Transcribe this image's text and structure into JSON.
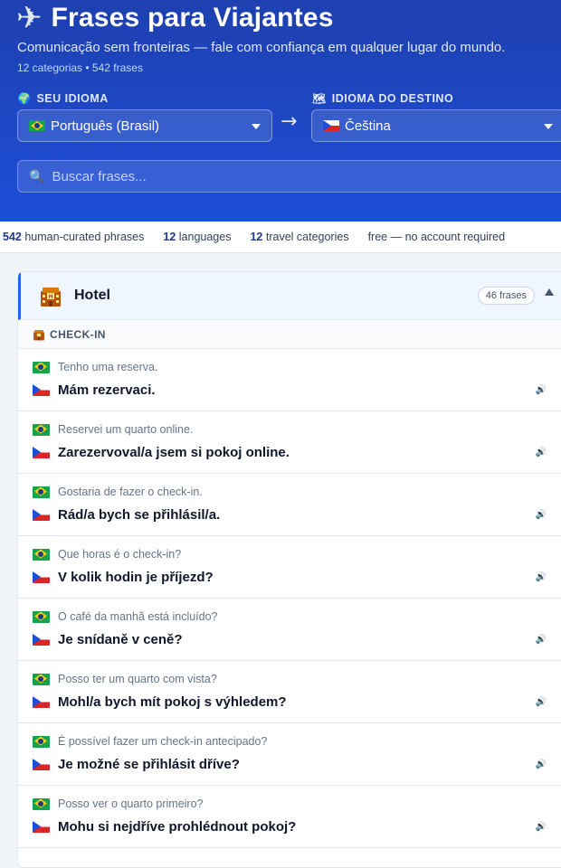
{
  "header": {
    "icon": "airplane-icon",
    "title": "Frases para Viajantes",
    "subtitle": "Comunicação sem fronteiras — fale com confiança em qualquer lugar do mundo.",
    "counts": "12 categorias • 542 frases"
  },
  "languages": {
    "source_label": "SEU IDIOMA",
    "source_value": "Português (Brasil)",
    "target_label": "IDIOMA DO DESTINO",
    "target_value": "Čeština",
    "arrow": "→"
  },
  "search": {
    "placeholder": "Buscar frases..."
  },
  "stats": [
    {
      "value": "542",
      "label": "human-curated phrases"
    },
    {
      "value": "12",
      "label": "languages"
    },
    {
      "value": "12",
      "label": "travel categories"
    },
    {
      "value": "",
      "label": "free — no account required"
    }
  ],
  "category": {
    "title": "Hotel",
    "count": "46 frases",
    "section": "CHECK-IN",
    "phrases": [
      {
        "source": "Tenho uma reserva.",
        "target": "Mám rezervaci."
      },
      {
        "source": "Reservei um quarto online.",
        "target": "Zarezervoval/a jsem si pokoj online."
      },
      {
        "source": "Gostaria de fazer o check-in.",
        "target": "Rád/a bych se přihlásil/a."
      },
      {
        "source": "Que horas é o check-in?",
        "target": "V kolik hodin je příjezd?"
      },
      {
        "source": "O café da manhã está incluído?",
        "target": "Je snídaně v ceně?"
      },
      {
        "source": "Posso ter um quarto com vista?",
        "target": "Mohl/a bych mít pokoj s výhledem?"
      },
      {
        "source": "É possível fazer um check-in antecipado?",
        "target": "Je možné se přihlásit dříve?"
      },
      {
        "source": "Posso ver o quarto primeiro?",
        "target": "Mohu si nejdříve prohlédnout pokoj?"
      }
    ]
  },
  "colors": {
    "header_bg": "#1e40af",
    "accent": "#2563eb"
  }
}
